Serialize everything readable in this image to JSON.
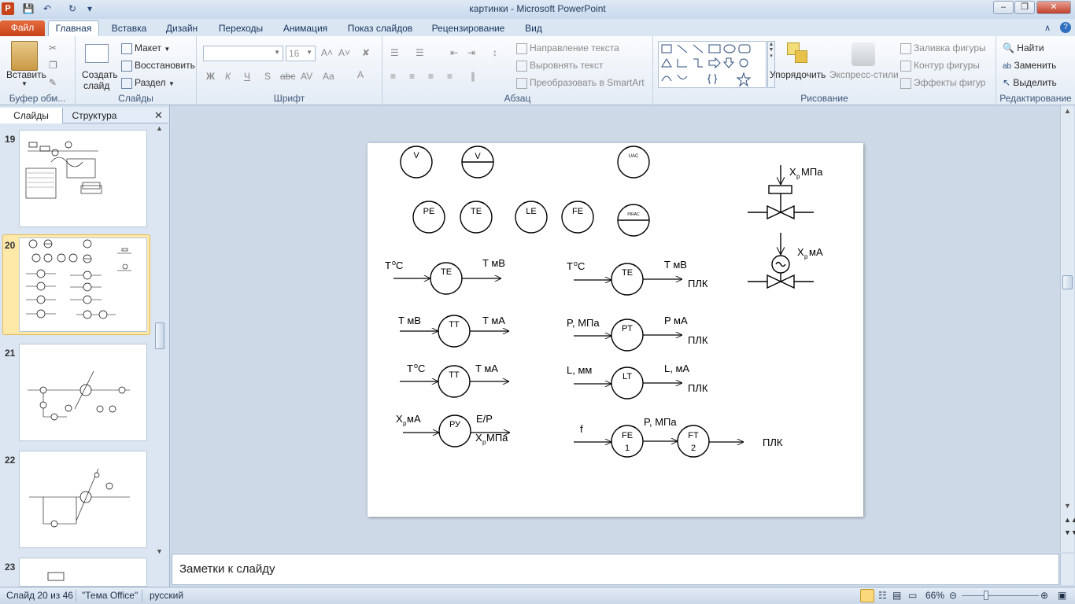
{
  "window": {
    "title": "картинки  -  Microsoft PowerPoint"
  },
  "tabs": [
    "Файл",
    "Главная",
    "Вставка",
    "Дизайн",
    "Переходы",
    "Анимация",
    "Показ слайдов",
    "Рецензирование",
    "Вид"
  ],
  "ribbon": {
    "clipboard": {
      "paste": "Вставить",
      "label": "Буфер обм..."
    },
    "slides": {
      "new_slide_1": "Создать",
      "new_slide_2": "слайд",
      "layout": "Макет",
      "reset": "Восстановить",
      "section": "Раздел",
      "label": "Слайды"
    },
    "font": {
      "size": "16",
      "label": "Шрифт"
    },
    "paragraph": {
      "text_direction": "Направление текста",
      "align_text": "Выровнять текст",
      "smartart": "Преобразовать в SmartArt",
      "label": "Абзац"
    },
    "drawing": {
      "arrange": "Упорядочить",
      "quick_styles": "Экспресс-стили",
      "shape_fill": "Заливка фигуры",
      "shape_outline": "Контур фигуры",
      "shape_effects": "Эффекты фигур",
      "label": "Рисование"
    },
    "editing": {
      "find": "Найти",
      "replace": "Заменить",
      "select": "Выделить",
      "label": "Редактирование"
    }
  },
  "pane": {
    "tab_slides": "Слайды",
    "tab_outline": "Структура",
    "thumb_numbers": [
      "19",
      "20",
      "21",
      "22",
      "23"
    ]
  },
  "slide": {
    "row1": [
      "V",
      "V",
      "UAC"
    ],
    "row2": [
      "PE",
      "TE",
      "LE",
      "FE",
      "PIRAC"
    ],
    "valve1": {
      "x": "X",
      "sub": "p",
      "unit": " МПа"
    },
    "valve2": {
      "x": "X",
      "sub": "p",
      "unit": " мА"
    },
    "left": {
      "te_in_T": "T",
      "te_in_sup": "o",
      "te_in_C": "C",
      "te_circle": "TE",
      "te_out": "T мВ",
      "tt1_in": "T мВ",
      "tt1_circle": "TT",
      "tt1_out": "T мА",
      "tt2_in_T": "T",
      "tt2_in_sup": "o",
      "tt2_in_C": "C",
      "tt2_circle": "TT",
      "tt2_out": "T мА",
      "ru_in_x": "X",
      "ru_in_sub": "p",
      "ru_in_unit": " мА",
      "ru_circle": "РУ",
      "ru_out1": "Е/Р",
      "ru_out2_x": "X",
      "ru_out2_sub": "p",
      "ru_out2_unit": " МПа"
    },
    "right": {
      "te_in_T": "T",
      "te_in_sup": "o",
      "te_in_C": "C",
      "te_circle": "TE",
      "te_out": "T мВ",
      "te_plc": "ПЛК",
      "pt_in": "P, МПа",
      "pt_circle": "PT",
      "pt_out": "P мА",
      "pt_plc": "ПЛК",
      "lt_in": "L, мм",
      "lt_circle": "LT",
      "lt_out": "L, мА",
      "lt_plc": "ПЛК",
      "fe_in": "f",
      "fe_circle_1": "FE",
      "fe_circle_2": "1",
      "mid": "P, МПа",
      "ft_circle_1": "FT",
      "ft_circle_2": "2",
      "plc": "ПЛК"
    }
  },
  "notes": {
    "placeholder": "Заметки к слайду"
  },
  "status": {
    "slide": "Слайд 20 из 46",
    "theme": "\"Тема Office\"",
    "lang": "русский",
    "zoom": "66%"
  }
}
